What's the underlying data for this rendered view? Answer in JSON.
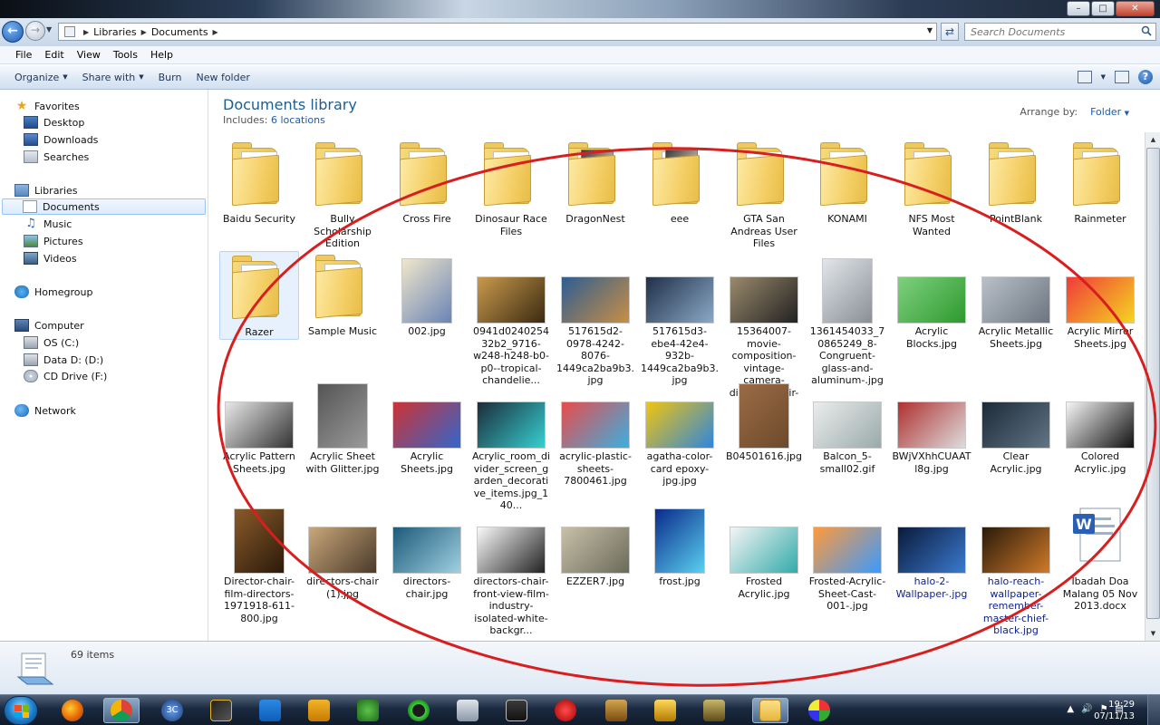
{
  "address": {
    "crumbs": [
      "Libraries",
      "Documents"
    ],
    "search_placeholder": "Search Documents"
  },
  "window_buttons": {
    "minimize": "–",
    "maximize": "□",
    "close": "✕"
  },
  "menu": [
    "File",
    "Edit",
    "View",
    "Tools",
    "Help"
  ],
  "toolbar": {
    "organize": "Organize",
    "share": "Share with",
    "burn": "Burn",
    "new_folder": "New folder"
  },
  "nav": {
    "favorites": "Favorites",
    "desktop": "Desktop",
    "downloads": "Downloads",
    "searches": "Searches",
    "libraries": "Libraries",
    "documents": "Documents",
    "music": "Music",
    "pictures": "Pictures",
    "videos": "Videos",
    "homegroup": "Homegroup",
    "computer": "Computer",
    "os": "OS (C:)",
    "data": "Data D: (D:)",
    "cd": "CD Drive (F:)",
    "network": "Network"
  },
  "library": {
    "title": "Documents library",
    "includes_label": "Includes:",
    "locations": "6 locations",
    "arrange_label": "Arrange by:",
    "arrange_value": "Folder"
  },
  "items": [
    {
      "name": "Baidu Security",
      "kind": "folder"
    },
    {
      "name": "Bully Scholarship Edition",
      "kind": "folder"
    },
    {
      "name": "Cross Fire",
      "kind": "folder"
    },
    {
      "name": "Dinosaur Race Files",
      "kind": "folder"
    },
    {
      "name": "DragonNest",
      "kind": "folder-photo"
    },
    {
      "name": "eee",
      "kind": "folder-photo"
    },
    {
      "name": "GTA San Andreas User Files",
      "kind": "folder"
    },
    {
      "name": "KONAMI",
      "kind": "folder"
    },
    {
      "name": "NFS Most Wanted",
      "kind": "folder"
    },
    {
      "name": "PointBlank",
      "kind": "folder"
    },
    {
      "name": "Rainmeter",
      "kind": "folder"
    },
    {
      "name": "Razer",
      "kind": "folder"
    },
    {
      "name": "Sample Music",
      "kind": "folder"
    },
    {
      "name": "002.jpg",
      "kind": "image"
    },
    {
      "name": "0941d024025432b2_9716-w248-h248-b0-p0--tropical-chandelie...",
      "kind": "image"
    },
    {
      "name": "517615d2-0978-4242-8076-1449ca2ba9b3.jpg",
      "kind": "image"
    },
    {
      "name": "517615d3-ebe4-42e4-932b-1449ca2ba9b3.jpg",
      "kind": "image"
    },
    {
      "name": "15364007-movie-composition-vintage-camera-director-chair-a...",
      "kind": "image"
    },
    {
      "name": "1361454033_70865249_8-Congruent-glass-and-aluminum-.jpg",
      "kind": "image"
    },
    {
      "name": "Acrylic Blocks.jpg",
      "kind": "image"
    },
    {
      "name": "Acrylic Metallic Sheets.jpg",
      "kind": "image"
    },
    {
      "name": "Acrylic Mirror Sheets.jpg",
      "kind": "image"
    },
    {
      "name": "Acrylic Pattern Sheets.jpg",
      "kind": "image"
    },
    {
      "name": "Acrylic Sheet with Glitter.jpg",
      "kind": "image"
    },
    {
      "name": "Acrylic Sheets.jpg",
      "kind": "image"
    },
    {
      "name": "Acrylic_room_divider_screen_garden_decorative_items.jpg_140...",
      "kind": "image"
    },
    {
      "name": "acrylic-plastic-sheets-7800461.jpg",
      "kind": "image"
    },
    {
      "name": "agatha-color-card epoxy-jpg.jpg",
      "kind": "image"
    },
    {
      "name": "B04501616.jpg",
      "kind": "image"
    },
    {
      "name": "Balcon_5-small02.gif",
      "kind": "image"
    },
    {
      "name": "BWjVXhhCUAATl8g.jpg",
      "kind": "image"
    },
    {
      "name": "Clear Acrylic.jpg",
      "kind": "image"
    },
    {
      "name": "Colored Acrylic.jpg",
      "kind": "image"
    },
    {
      "name": "Director-chair-film-directors-1971918-611-800.jpg",
      "kind": "image"
    },
    {
      "name": "directors-chair (1).jpg",
      "kind": "image"
    },
    {
      "name": "directors-chair.jpg",
      "kind": "image"
    },
    {
      "name": "directors-chair-front-view-film-industry-isolated-white-backgr...",
      "kind": "image"
    },
    {
      "name": "EZZER7.jpg",
      "kind": "image"
    },
    {
      "name": "frost.jpg",
      "kind": "image"
    },
    {
      "name": "Frosted Acrylic.jpg",
      "kind": "image"
    },
    {
      "name": "Frosted-Acrylic-Sheet-Cast-001-.jpg",
      "kind": "image"
    },
    {
      "name": "halo-2-Wallpaper-.jpg",
      "kind": "image"
    },
    {
      "name": "halo-reach-wallpaper-remember-master-chief-black.jpg",
      "kind": "image"
    },
    {
      "name": "Ibadah Doa Malang 05 Nov 2013.docx",
      "kind": "docx"
    }
  ],
  "status": {
    "count": "69 items"
  },
  "clock": {
    "time": "19:29",
    "date": "07/11/13"
  },
  "colors": {
    "accent_title": "#1e5d8e",
    "link": "#1e5bab",
    "annotation": "#d81f1f"
  }
}
